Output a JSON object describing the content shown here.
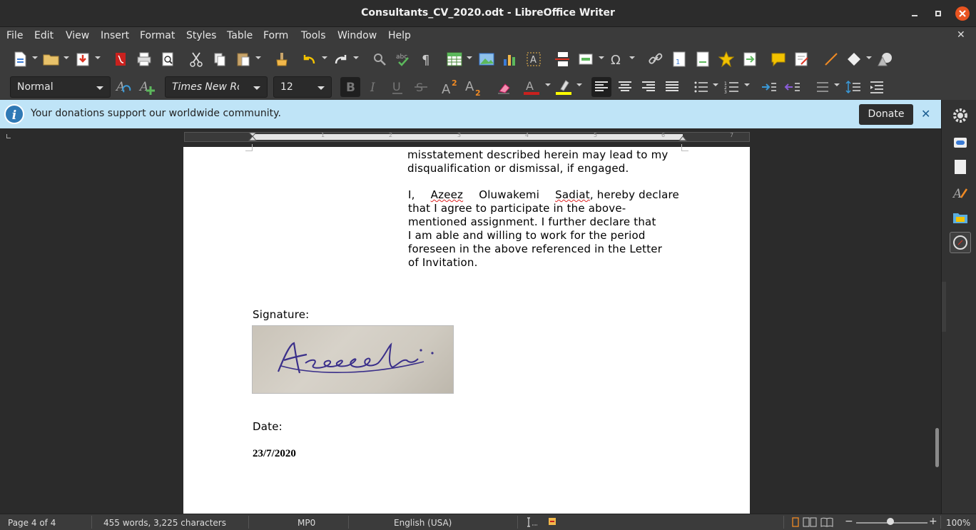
{
  "window": {
    "title": "Consultants_CV_2020.odt - LibreOffice Writer"
  },
  "menu": [
    "File",
    "Edit",
    "View",
    "Insert",
    "Format",
    "Styles",
    "Table",
    "Form",
    "Tools",
    "Window",
    "Help"
  ],
  "format_bar": {
    "paragraph_style": "Normal",
    "font_name": "Times New Roman",
    "font_size": "12"
  },
  "infobar": {
    "message": "Your donations support our worldwide community.",
    "donate_label": "Donate"
  },
  "document": {
    "para1_line1": "misstatement described herein may lead to my",
    "para1_line2": "disqualification or dismissal, if engaged.",
    "para2_line1_pre": "I, ",
    "para2_name1": "Azeez",
    "para2_name2": "Oluwakemi",
    "para2_name3": "Sadiat",
    "para2_line1_post": ", hereby declare",
    "para2_line2": "that I agree to participate in the above-",
    "para2_line3": "mentioned assignment. I further declare that",
    "para2_line4": "I am able and willing to work for the period",
    "para2_line5": "foreseen in the above referenced in the Letter",
    "para2_line6": "of Invitation.",
    "signature_label": "Signature:",
    "signature_text": "Azeesadi",
    "date_label": "Date:",
    "date_value": "23/7/2020"
  },
  "ruler_numbers": [
    "1",
    "2",
    "3",
    "4",
    "5",
    "6",
    "7"
  ],
  "status": {
    "page": "Page 4 of 4",
    "words": "455 words, 3,225 characters",
    "page_style": "MP0",
    "language": "English (USA)",
    "zoom": "100%"
  },
  "colors": {
    "infobar_bg": "#bfe4f7",
    "accent_close": "#e95420",
    "font_color": "#c9211e",
    "highlight": "#ffff00"
  }
}
